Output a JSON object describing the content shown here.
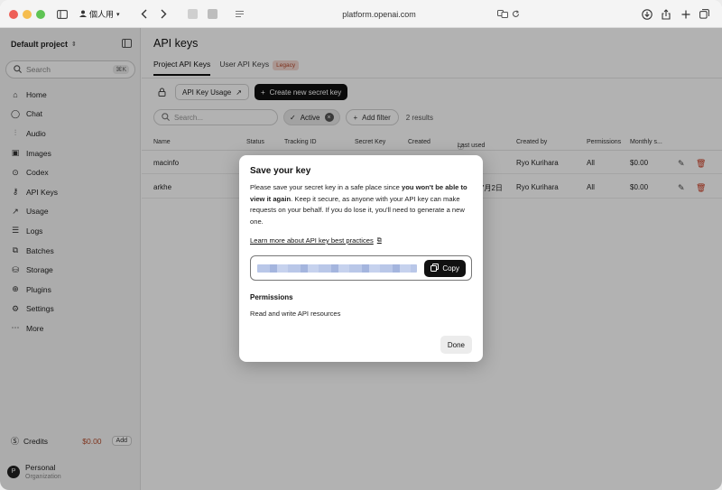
{
  "browser": {
    "profile": "個人用",
    "url": "platform.openai.com"
  },
  "sidebar": {
    "project": "Default project",
    "search_placeholder": "Search",
    "search_shortcut": "⌘K",
    "items": [
      {
        "label": "Home",
        "icon": "home-icon"
      },
      {
        "label": "Chat",
        "icon": "chat-icon"
      },
      {
        "label": "Audio",
        "icon": "audio-icon"
      },
      {
        "label": "Images",
        "icon": "image-icon"
      },
      {
        "label": "Codex",
        "icon": "codex-icon"
      },
      {
        "label": "API Keys",
        "icon": "key-icon"
      },
      {
        "label": "Usage",
        "icon": "usage-icon"
      },
      {
        "label": "Logs",
        "icon": "logs-icon"
      },
      {
        "label": "Batches",
        "icon": "batches-icon"
      },
      {
        "label": "Storage",
        "icon": "storage-icon"
      },
      {
        "label": "Plugins",
        "icon": "plugins-icon"
      },
      {
        "label": "Settings",
        "icon": "settings-icon"
      },
      {
        "label": "More",
        "icon": "more-icon"
      }
    ],
    "credits_label": "Credits",
    "credits_amount": "$0.00",
    "credits_add": "Add",
    "account_name": "Personal",
    "account_type": "Organization",
    "avatar_letter": "P"
  },
  "main": {
    "title": "API keys",
    "tabs": [
      {
        "label": "Project API Keys"
      },
      {
        "label": "User API Keys"
      }
    ],
    "legacy_badge": "Legacy",
    "usage_button": "API Key Usage",
    "create_button": "Create new secret key",
    "search_placeholder": "Search...",
    "filter_chip": "Active",
    "add_filter": "Add filter",
    "result_count": "2 results",
    "columns": [
      "Name",
      "Status",
      "Tracking ID",
      "Secret Key",
      "Created",
      "Last used",
      "Created by",
      "Permissions",
      "Monthly s..."
    ],
    "rows": [
      {
        "name": "macinfo",
        "created_by": "Ryo Kurihara",
        "permissions": "All",
        "monthly": "$0.00",
        "last_used": ""
      },
      {
        "name": "arkhe",
        "created_by": "Ryo Kurihara",
        "permissions": "All",
        "monthly": "$0.00",
        "last_used": "7月2日"
      }
    ]
  },
  "modal": {
    "title": "Save your key",
    "body_1": "Please save your secret key in a safe place since ",
    "body_bold": "you won't be able to view it again",
    "body_2": ". Keep it secure, as anyone with your API key can make requests on your behalf. If you do lose it, you'll need to generate a new one.",
    "link": "Learn more about API key best practices",
    "copy_button": "Copy",
    "permissions_heading": "Permissions",
    "permissions_value": "Read and write API resources",
    "done_button": "Done"
  }
}
